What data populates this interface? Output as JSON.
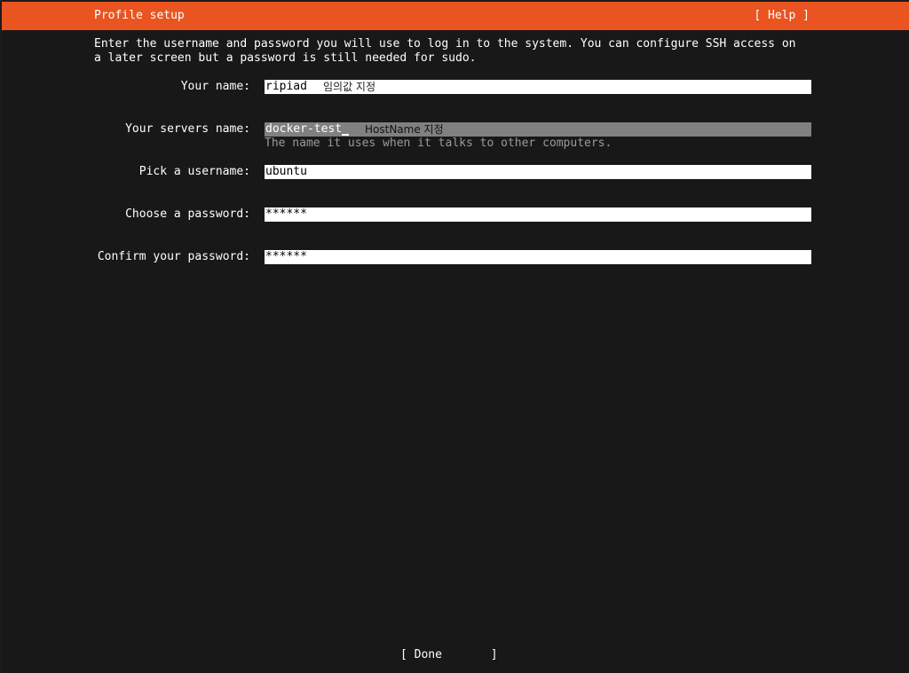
{
  "header": {
    "title": "Profile setup",
    "help_label": "[ Help ]",
    "color": "#e95420"
  },
  "intro": {
    "line1": "Enter the username and password you will use to log in to the system. You can configure SSH access on",
    "line2": "a later screen but a password is still needed for sudo."
  },
  "fields": {
    "name": {
      "label": "Your name:",
      "value": "ripiad",
      "note": "임의값 지정"
    },
    "server": {
      "label": "Your servers name:",
      "value": "docker-test",
      "note": "HostName 지정",
      "help": "The name it uses when it talks to other computers."
    },
    "username": {
      "label": "Pick a username:",
      "value": "ubuntu"
    },
    "password": {
      "label": "Choose a password:",
      "value": "******"
    },
    "confirm": {
      "label": "Confirm your password:",
      "value": "******"
    }
  },
  "footer": {
    "done_label": "[ Done       ]"
  }
}
